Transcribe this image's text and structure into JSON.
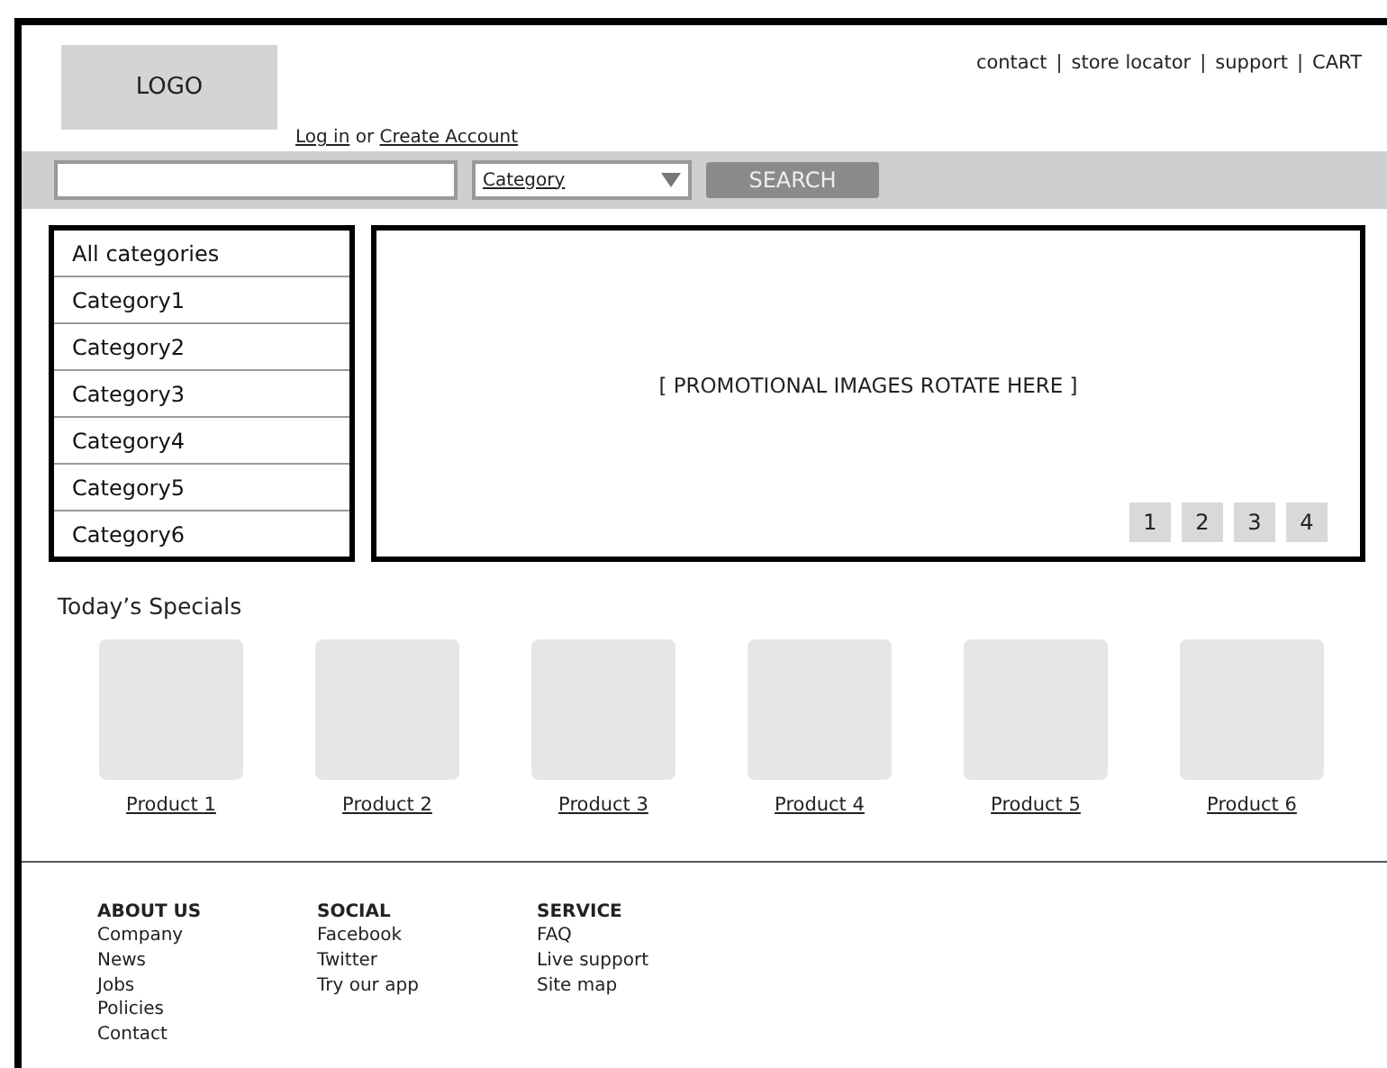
{
  "header": {
    "logo": "LOGO",
    "account_links": [
      {
        "label": "Log in"
      },
      {
        "label": "or",
        "kind": "text"
      },
      {
        "label": "Create Account"
      }
    ],
    "top_links": [
      "contact",
      "store locator",
      "support",
      "CART"
    ],
    "top_link_separator": "|"
  },
  "search": {
    "category_select": "Category",
    "button": "SEARCH"
  },
  "categories": [
    {
      "label": "All categories"
    },
    {
      "label": "Category1"
    },
    {
      "label": "Category2"
    },
    {
      "label": "Category3"
    },
    {
      "label": "Category4"
    },
    {
      "label": "Category5"
    },
    {
      "label": "Category6"
    }
  ],
  "promo": {
    "text": "[ PROMOTIONAL IMAGES ROTATE HERE ]",
    "pages": [
      "1",
      "2",
      "3",
      "4"
    ]
  },
  "specials": {
    "title": "Today’s Specials",
    "products": [
      "Product 1",
      "Product 2",
      "Product 3",
      "Product 4",
      "Product 5",
      "Product 6"
    ]
  },
  "footer": [
    {
      "heading": "ABOUT US",
      "links": [
        "Company",
        "News",
        "Jobs",
        "Policies",
        "Contact"
      ]
    },
    {
      "heading": "SOCIAL",
      "links": [
        "Facebook",
        "Twitter",
        "Try our app"
      ]
    },
    {
      "heading": "SERVICE",
      "links": [
        "FAQ",
        "Live support",
        "Site map"
      ]
    }
  ]
}
